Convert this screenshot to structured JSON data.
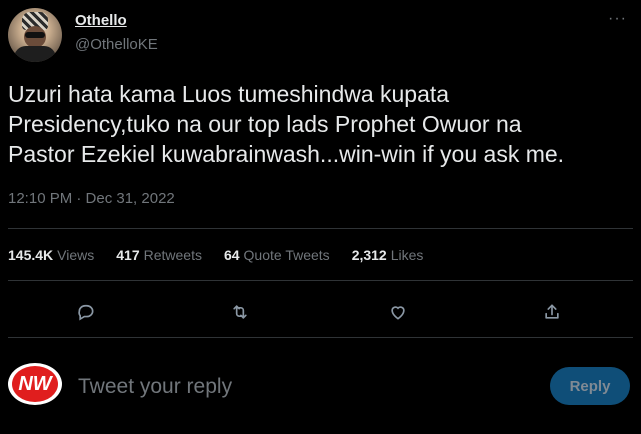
{
  "author": {
    "name": "Othello",
    "handle": "@OthelloKE"
  },
  "tweet": {
    "text": "Uzuri hata kama Luos tumeshindwa kupata\nPresidency,tuko na our top lads Prophet Owuor na\nPastor Ezekiel kuwabrainwash...win-win if you ask me.",
    "timestamp": "12:10 PM · Dec 31, 2022"
  },
  "stats": [
    {
      "value": "145.4K",
      "label": "Views"
    },
    {
      "value": "417",
      "label": "Retweets"
    },
    {
      "value": "64",
      "label": "Quote Tweets"
    },
    {
      "value": "2,312",
      "label": "Likes"
    }
  ],
  "actions": {
    "reply_icon": "comment-icon",
    "retweet_icon": "retweet-icon",
    "like_icon": "heart-icon",
    "share_icon": "share-icon"
  },
  "composer": {
    "avatar_text": "NW",
    "placeholder": "Tweet your reply",
    "button_label": "Reply"
  },
  "colors": {
    "background": "#000000",
    "text": "#e7e9ea",
    "muted": "#71767b",
    "accent_disabled": "#0f4e78",
    "nw_red": "#e01e1e"
  }
}
